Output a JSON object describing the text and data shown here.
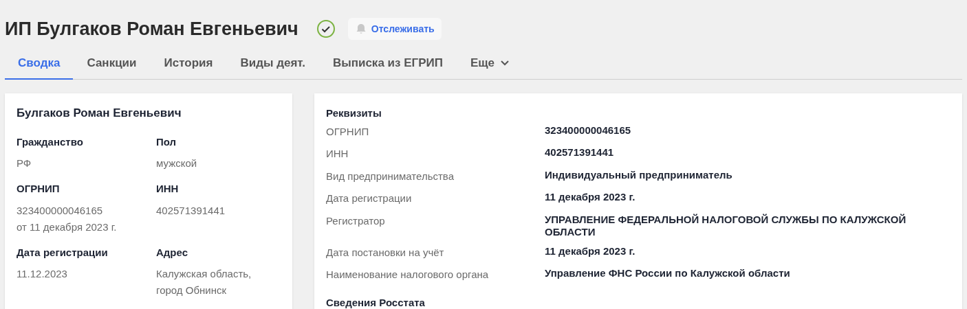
{
  "title": "ИП Булгаков Роман Евгеньевич",
  "follow_button": {
    "label": "Отслеживать"
  },
  "tabs": [
    {
      "label": "Сводка",
      "selected": true
    },
    {
      "label": "Санкции",
      "selected": false
    },
    {
      "label": "История",
      "selected": false
    },
    {
      "label": "Виды деят.",
      "selected": false
    },
    {
      "label": "Выписка из ЕГРИП",
      "selected": false
    },
    {
      "label": "Еще",
      "selected": false,
      "kind": "dropdown"
    }
  ],
  "summary_card": {
    "name": "Булгаков Роман Евгеньевич",
    "fields": [
      {
        "label": "Гражданство",
        "values": [
          "РФ"
        ]
      },
      {
        "label": "Пол",
        "values": [
          "мужской"
        ]
      },
      {
        "label": "ОГРНИП",
        "values": [
          "323400000046165",
          "от 11 декабря 2023 г."
        ]
      },
      {
        "label": "ИНН",
        "values": [
          "402571391441"
        ]
      },
      {
        "label": "Дата регистрации",
        "values": [
          "11.12.2023"
        ]
      },
      {
        "label": "Адрес",
        "values": [
          "Калужская область,",
          "город Обнинск"
        ]
      }
    ]
  },
  "details_card": {
    "section": "Реквизиты",
    "rows": [
      {
        "label": "ОГРНИП",
        "value": "323400000046165"
      },
      {
        "label": "ИНН",
        "value": "402571391441"
      },
      {
        "label": "Вид предпринимательства",
        "value": "Индивидуальный предприниматель"
      },
      {
        "label": "Дата регистрации",
        "value": "11 декабря 2023 г."
      },
      {
        "label": "Регистратор",
        "value": "УПРАВЛЕНИЕ ФЕДЕРАЛЬНОЙ НАЛОГОВОЙ СЛУЖБЫ ПО КАЛУЖСКОЙ ОБЛАСТИ"
      },
      {
        "label": "Дата постановки на учёт",
        "value": "11 декабря 2023 г."
      },
      {
        "label": "Наименование налогового органа",
        "value": "Управление ФНС России по Калужской области"
      }
    ],
    "next_section": "Сведения Росстата"
  }
}
